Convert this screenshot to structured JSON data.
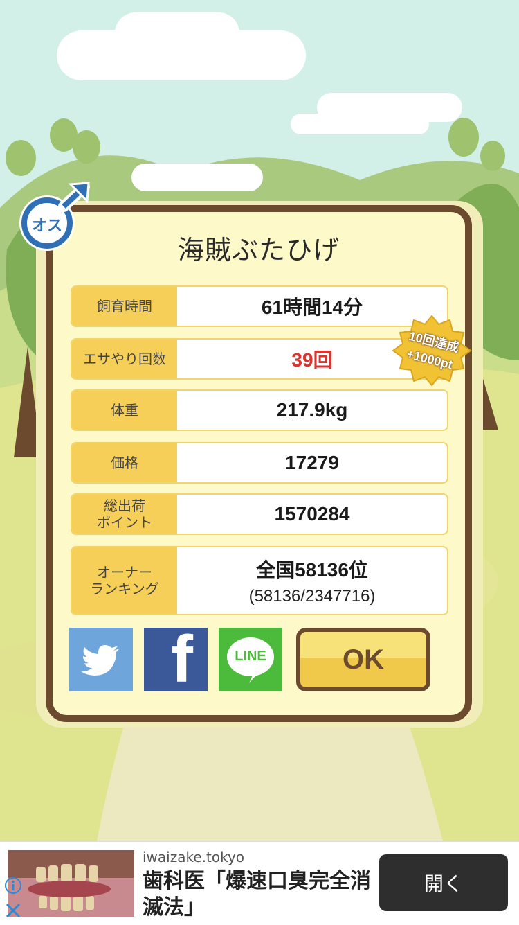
{
  "pet": {
    "gender_icon_text": "オス",
    "name": "海賊ぶたひげ"
  },
  "stats": [
    {
      "label": "飼育時間",
      "value": "61時間14分"
    },
    {
      "label": "エサやり回数",
      "value": "39回"
    },
    {
      "label": "体重",
      "value": "217.9kg"
    },
    {
      "label": "価格",
      "value": "17279"
    },
    {
      "label": "総出荷\nポイント",
      "value": "1570284"
    },
    {
      "label": "オーナー\nランキング",
      "value": "全国58136位",
      "sub": "(58136/2347716)"
    }
  ],
  "badge": {
    "line1": "10回達成",
    "line2": "+1000pt"
  },
  "share": {
    "twitter_icon": "twitter-bird-icon",
    "facebook_label": "f",
    "line_label": "LINE"
  },
  "ok_label": "OK",
  "ad": {
    "domain": "iwaizake.tokyo",
    "title": "歯科医「爆速口臭完全消滅法」",
    "open_label": "開く"
  },
  "colors": {
    "modal_border": "#6b4a2e",
    "label_bg": "#f6cf58",
    "highlight_red": "#e0322c",
    "twitter": "#6ea6dc",
    "facebook": "#3b5998",
    "line": "#4cba3a"
  }
}
